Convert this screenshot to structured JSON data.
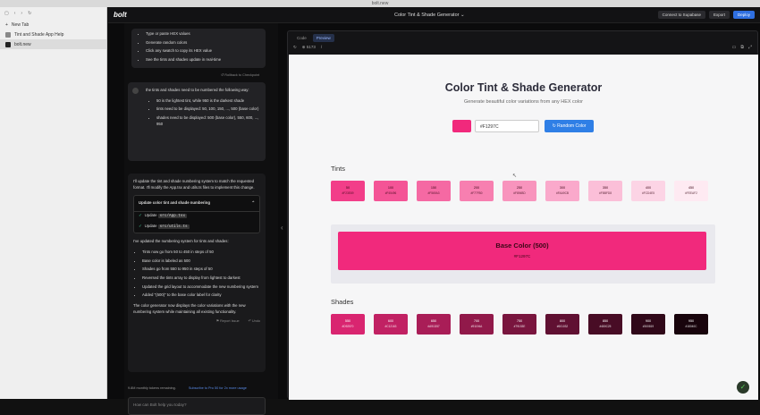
{
  "window": {
    "title": "bolt.new"
  },
  "left_pane": {
    "new_tab": "New Tab",
    "tabs": [
      {
        "label": "Tint and Shade App Help"
      },
      {
        "label": "bolt.new"
      }
    ]
  },
  "topbar": {
    "logo": "bolt",
    "project_title": "Color Tint & Shade Generator",
    "connect_label": "Connect to Supabase",
    "export_label": "Export",
    "deploy_label": "Deploy"
  },
  "chat": {
    "first_bubble": [
      "Type or paste HEX values",
      "Generate random colors",
      "Click any swatch to copy its HEX value",
      "See the tints and shades update in real-time"
    ],
    "rollback_label": "Rollback to Checkpoint",
    "user_msg_intro": "the tints and shades need to be numbered the following way:",
    "user_msg_items": [
      "50 is the lightest tint, while 950 is the darkest shade",
      "tints need to be displayed: 50, 100, 150, ..., 500 (base color)",
      "shades need to be displayed: 500 (base color), 550, 600, ..., 950"
    ],
    "ai_intro": "I'll update the tint and shade numbering system to match the requested format. I'll modify the App.tsx and utils.ts files to implement this change.",
    "update_title": "Update color tint and shade numbering",
    "update_prefix": "Update",
    "update_files": [
      "src/App.tsx",
      "src/utils.ts"
    ],
    "ai_summary_intro": "I've updated the numbering system for tints and shades:",
    "ai_summary_items": [
      "Tints now go from 50 to 450 in steps of 50",
      "Base color is labeled as 500",
      "Shades go from 550 to 950 in steps of 50",
      "Reversed the tints array to display from lightest to darkest",
      "Updated the grid layout to accommodate the new numbering system",
      "Added \"(500)\" to the base color label for clarity"
    ],
    "ai_outro": "The color generator now displays the color variations with the new numbering system while maintaining all existing functionality.",
    "report_issue": "Report Issue",
    "undo": "Undo",
    "tokens_remaining": "9.8M monthly tokens remaining.",
    "subscribe_link": "Subscribe to Pro 50 for 2x more usage",
    "input_placeholder": "How can Bolt help you today?"
  },
  "preview": {
    "tab_code": "Code",
    "tab_preview": "Preview",
    "url_port": "5173",
    "url_path": "/"
  },
  "app": {
    "title": "Color Tint & Shade Generator",
    "subtitle": "Generate beautiful color variations from any HEX color",
    "hex_value": "#F1297C",
    "base_color": "#F1297C",
    "random_label": "Random Color",
    "tints_heading": "Tints",
    "shades_heading": "Shades",
    "base_label": "Base Color (500)",
    "base_hex": "#F1297C",
    "tints": [
      {
        "label": "50",
        "hex": "#F23E89",
        "color": "#f23e89",
        "text": "#3a0716"
      },
      {
        "label": "100",
        "hex": "#F45496",
        "color": "#f45496",
        "text": "#3a0716"
      },
      {
        "label": "150",
        "hex": "#F569A3",
        "color": "#f569a3",
        "text": "#3a0716"
      },
      {
        "label": "200",
        "hex": "#F77FB0",
        "color": "#f77fb0",
        "text": "#3a0716"
      },
      {
        "label": "250",
        "hex": "#F894BD",
        "color": "#f894bd",
        "text": "#3a0716"
      },
      {
        "label": "300",
        "hex": "#FAA9CB",
        "color": "#faa9cb",
        "text": "#3a0716"
      },
      {
        "label": "350",
        "hex": "#FBBFD8",
        "color": "#fbbfd8",
        "text": "#3a0716"
      },
      {
        "label": "400",
        "hex": "#FCD4E5",
        "color": "#fcd4e5",
        "text": "#3a0716"
      },
      {
        "label": "450",
        "hex": "#FEEAF2",
        "color": "#feeaf2",
        "text": "#3a0716"
      }
    ],
    "shades": [
      {
        "label": "550",
        "hex": "#D92570",
        "color": "#d92570",
        "text": "#ffffff"
      },
      {
        "label": "600",
        "hex": "#C12163",
        "color": "#c12163",
        "text": "#ffffff"
      },
      {
        "label": "650",
        "hex": "#A91D57",
        "color": "#a91d57",
        "text": "#ffffff"
      },
      {
        "label": "700",
        "hex": "#91194A",
        "color": "#91194a",
        "text": "#ffffff"
      },
      {
        "label": "750",
        "hex": "#79153E",
        "color": "#79153e",
        "text": "#ffffff"
      },
      {
        "label": "800",
        "hex": "#601032",
        "color": "#601032",
        "text": "#ffffff"
      },
      {
        "label": "850",
        "hex": "#480C25",
        "color": "#480c25",
        "text": "#ffffff"
      },
      {
        "label": "900",
        "hex": "#300819",
        "color": "#300819",
        "text": "#ffffff"
      },
      {
        "label": "950",
        "hex": "#18040C",
        "color": "#18040c",
        "text": "#ffffff"
      }
    ]
  }
}
